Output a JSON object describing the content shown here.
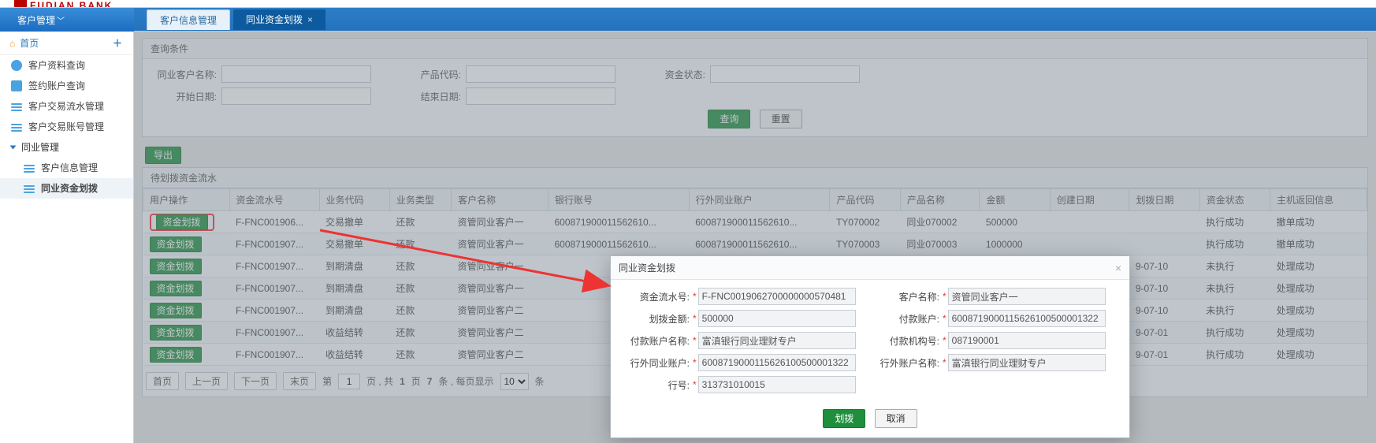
{
  "logo_text": "FUDIAN BANK",
  "header_module": "客户管理",
  "tabs": [
    {
      "label": "客户信息管理",
      "active": false
    },
    {
      "label": "同业资金划拨",
      "active": true
    }
  ],
  "sidebar": {
    "home": "首页",
    "items": [
      {
        "label": "客户资料查询"
      },
      {
        "label": "签约账户查询"
      },
      {
        "label": "客户交易流水管理"
      },
      {
        "label": "客户交易账号管理"
      },
      {
        "label": "同业管理",
        "parent": true
      },
      {
        "label": "客户信息管理",
        "sub": true
      },
      {
        "label": "同业资金划拨",
        "sub": true,
        "active": true
      }
    ]
  },
  "query_section_title": "查询条件",
  "query": {
    "customer_name_label": "同业客户名称:",
    "product_code_label": "产品代码:",
    "fund_status_label": "资金状态:",
    "start_date_label": "开始日期:",
    "end_date_label": "结束日期:"
  },
  "buttons": {
    "query": "查询",
    "reset": "重置",
    "export": "导出"
  },
  "list_section_title": "待划拨资金流水",
  "table": {
    "columns": [
      "用户操作",
      "资金流水号",
      "业务代码",
      "业务类型",
      "客户名称",
      "银行账号",
      "行外同业账户",
      "产品代码",
      "产品名称",
      "金额",
      "创建日期",
      "划拨日期",
      "资金状态",
      "主机返回信息"
    ],
    "op_label": "资金划拨",
    "rows": [
      {
        "flow": "F-FNC001906...",
        "bizcode": "交易撤单",
        "biztype": "还款",
        "cust": "资管同业客户一",
        "bank": "600871900011562610...",
        "out": "600871900011562610...",
        "pcode": "TY070002",
        "pname": "同业070002",
        "amt": "500000",
        "cdate": "",
        "tdate": "",
        "status": "执行成功",
        "ret": "撤单成功"
      },
      {
        "flow": "F-FNC001907...",
        "bizcode": "交易撤单",
        "biztype": "还款",
        "cust": "资管同业客户一",
        "bank": "600871900011562610...",
        "out": "600871900011562610...",
        "pcode": "TY070003",
        "pname": "同业070003",
        "amt": "1000000",
        "cdate": "",
        "tdate": "",
        "status": "执行成功",
        "ret": "撤单成功"
      },
      {
        "flow": "F-FNC001907...",
        "bizcode": "到期清盘",
        "biztype": "还款",
        "cust": "资管同业客户一",
        "bank": "",
        "out": "",
        "pcode": "",
        "pname": "",
        "amt": "",
        "cdate": "",
        "tdate": "9-07-10",
        "status": "未执行",
        "ret": "处理成功"
      },
      {
        "flow": "F-FNC001907...",
        "bizcode": "到期清盘",
        "biztype": "还款",
        "cust": "资管同业客户一",
        "bank": "",
        "out": "",
        "pcode": "",
        "pname": "",
        "amt": "",
        "cdate": "",
        "tdate": "9-07-10",
        "status": "未执行",
        "ret": "处理成功"
      },
      {
        "flow": "F-FNC001907...",
        "bizcode": "到期清盘",
        "biztype": "还款",
        "cust": "资管同业客户二",
        "bank": "",
        "out": "",
        "pcode": "",
        "pname": "",
        "amt": "",
        "cdate": "",
        "tdate": "9-07-10",
        "status": "未执行",
        "ret": "处理成功"
      },
      {
        "flow": "F-FNC001907...",
        "bizcode": "收益结转",
        "biztype": "还款",
        "cust": "资管同业客户二",
        "bank": "",
        "out": "",
        "pcode": "",
        "pname": "",
        "amt": "",
        "cdate": "",
        "tdate": "9-07-01",
        "status": "执行成功",
        "ret": "处理成功"
      },
      {
        "flow": "F-FNC001907...",
        "bizcode": "收益结转",
        "biztype": "还款",
        "cust": "资管同业客户二",
        "bank": "",
        "out": "",
        "pcode": "",
        "pname": "",
        "amt": "",
        "cdate": "",
        "tdate": "9-07-01",
        "status": "执行成功",
        "ret": "处理成功"
      }
    ]
  },
  "pager": {
    "first": "首页",
    "prev": "上一页",
    "next": "下一页",
    "last": "末页",
    "page_prefix": "第",
    "page_no": "1",
    "page_suffix": "页 , 共",
    "total_pages": "1",
    "total_pages_suffix": "页",
    "total_rows": "7",
    "rows_suffix": "条 , 每页显示",
    "per_page": "10",
    "per_page_suffix": "条"
  },
  "dialog": {
    "title": "同业资金划拨",
    "fields": {
      "flow_no_label": "资金流水号:",
      "flow_no": "F-FNC0019062700000000570481",
      "cust_label": "客户名称:",
      "cust": "资管同业客户一",
      "amount_label": "划拨金额:",
      "amount": "500000",
      "pay_acct_label": "付款账户:",
      "pay_acct": "6008719000115626100500001322",
      "pay_name_label": "付款账户名称:",
      "pay_name": "富滇银行同业理财专户",
      "pay_org_label": "付款机构号:",
      "pay_org": "087190001",
      "out_acct_label": "行外同业账户:",
      "out_acct": "6008719000115626100500001322",
      "out_name_label": "行外账户名称:",
      "out_name": "富滇银行同业理财专户",
      "bank_no_label": "行号:",
      "bank_no": "313731010015"
    },
    "ok": "划拨",
    "cancel": "取消"
  }
}
